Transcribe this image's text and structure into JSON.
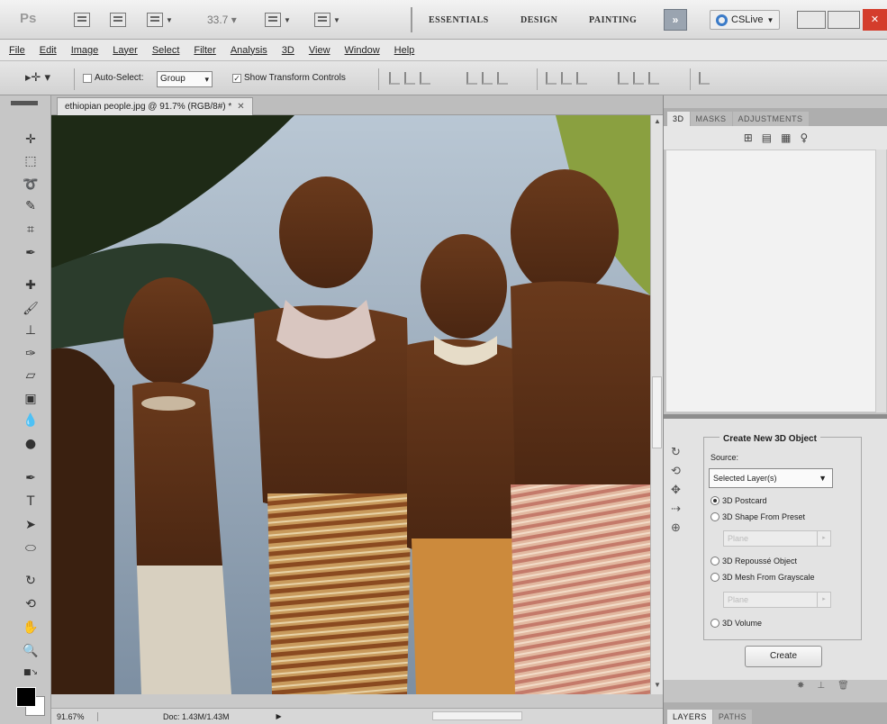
{
  "app": {
    "zoom_level": "33.7",
    "workspaces": [
      "ESSENTIALS",
      "DESIGN",
      "PAINTING"
    ],
    "more_button": "»",
    "cslive": "CSLive",
    "close": "✕"
  },
  "menu": [
    "File",
    "Edit",
    "Image",
    "Layer",
    "Select",
    "Filter",
    "Analysis",
    "3D",
    "View",
    "Window",
    "Help"
  ],
  "options": {
    "auto_select": "Auto-Select:",
    "auto_select_value": "Group",
    "show_transform": "Show Transform Controls"
  },
  "document": {
    "tab_title": "ethiopian people.jpg @ 91.7% (RGB/8#) *",
    "tab_close": "✕",
    "status_zoom": "91.67%",
    "status_doc": "Doc: 1.43M/1.43M"
  },
  "panels": {
    "top_tabs": [
      "3D",
      "MASKS",
      "ADJUSTMENTS"
    ],
    "bottom_tabs": [
      "LAYERS",
      "PATHS"
    ]
  },
  "create3d": {
    "title": "Create New 3D Object",
    "source_label": "Source:",
    "source_value": "Selected Layer(s)",
    "options": [
      {
        "label": "3D Postcard",
        "selected": true
      },
      {
        "label": "3D Shape From Preset",
        "selected": false
      },
      {
        "label": "3D Repoussé Object",
        "selected": false
      },
      {
        "label": "3D Mesh From Grayscale",
        "selected": false
      },
      {
        "label": "3D Volume",
        "selected": false
      }
    ],
    "preset_placeholder": "Plane",
    "grayscale_placeholder": "Plane",
    "create_label": "Create"
  },
  "colors": {
    "close_red": "#d43d2c",
    "cslive_blue": "#3b7bc8",
    "foreground": "#000000",
    "background": "#ffffff"
  }
}
